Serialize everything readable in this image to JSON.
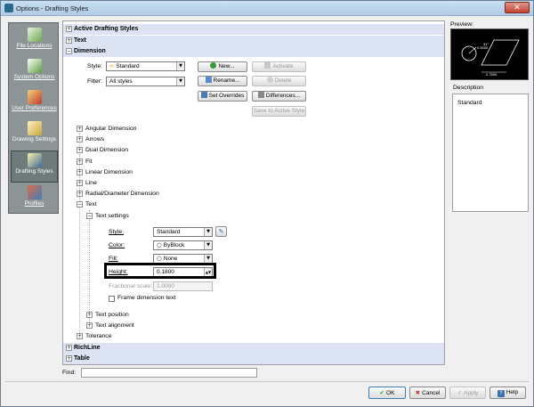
{
  "window": {
    "title": "Options - Drafting Styles",
    "close_glyph": "✕"
  },
  "sidebar": {
    "items": [
      {
        "label": "File Locations",
        "icon": "file-locations-icon"
      },
      {
        "label": "System Options",
        "icon": "system-options-icon"
      },
      {
        "label": "User Preferences",
        "icon": "user-preferences-icon"
      },
      {
        "label": "Drawing Settings",
        "icon": "drawing-settings-icon"
      },
      {
        "label": "Drafting Styles",
        "icon": "drafting-styles-icon",
        "active": true
      },
      {
        "label": "Profiles",
        "icon": "profiles-icon"
      }
    ]
  },
  "sections": {
    "active_drafting_styles": "Active Drafting Styles",
    "text": "Text",
    "dimension": "Dimension",
    "richline": "RichLine",
    "table": "Table"
  },
  "dimension": {
    "style_label": "Style:",
    "style_value": "Standard",
    "filter_label": "Filter:",
    "filter_value": "All styles",
    "buttons": {
      "new": "New...",
      "activate": "Activate",
      "rename": "Rename...",
      "delete": "Delete",
      "set_overrides": "Set Overrides",
      "differences": "Differences...",
      "save_to_active": "Save to Active Style"
    },
    "tree": {
      "angular": "Angular Dimension",
      "arrows": "Arrows",
      "dual": "Dual Dimension",
      "fit": "Fit",
      "linear": "Linear Dimension",
      "line": "Line",
      "radial": "Radial/Diameter Dimension",
      "text": "Text",
      "text_settings": "Text settings",
      "text_position": "Text position",
      "text_alignment": "Text alignment",
      "tolerance": "Tolerance"
    },
    "text_settings": {
      "style_label": "Style:",
      "style_value": "Standard",
      "color_label": "Color:",
      "color_value": "ByBlock",
      "fill_label": "Fill:",
      "fill_value": "None",
      "height_label": "Height:",
      "height_value": "0.1800",
      "fractional_label": "Fractional scale:",
      "fractional_value": "1.0000",
      "frame_label": "Frame dimension text",
      "frame_checked": false
    }
  },
  "preview": {
    "label": "Preview:",
    "dim_text_1": "0.5000",
    "dim_text_2": "2.7500",
    "dim_text_3": "31°"
  },
  "description": {
    "label": "Description",
    "value": "Standard"
  },
  "find": {
    "label": "Find:",
    "value": ""
  },
  "footer": {
    "ok": "OK",
    "cancel": "Cancel",
    "apply": "Apply",
    "help": "Help"
  }
}
